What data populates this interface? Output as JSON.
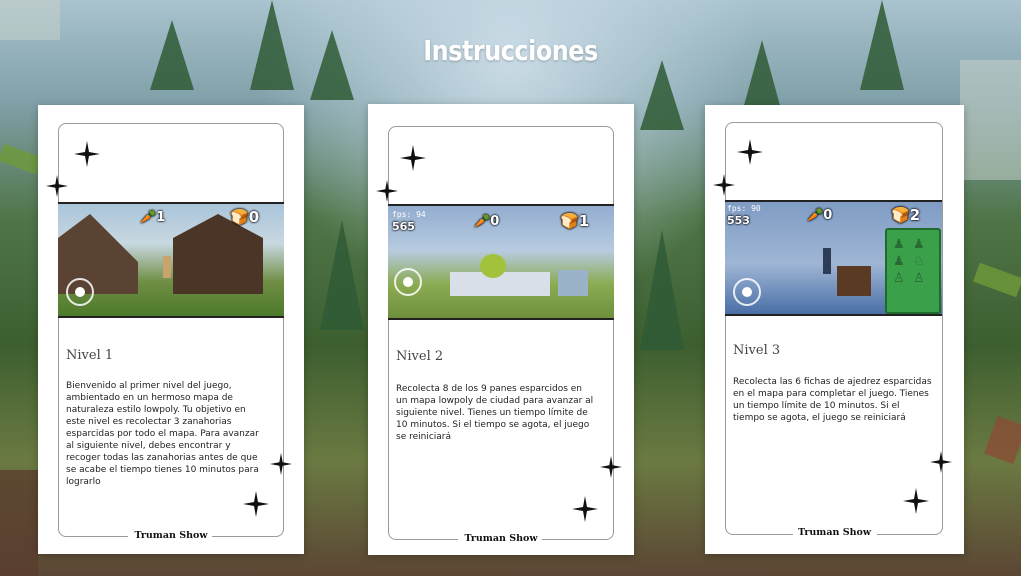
{
  "title": "Instrucciones",
  "cards": [
    {
      "level": "Nivel 1",
      "description": "Bienvenido al primer nivel del juego, ambientado en un hermoso mapa de naturaleza estilo lowpoly. Tu objetivo en este nivel es recolectar 3 zanahorias esparcidas por todo el mapa. Para avanzar al siguiente nivel, debes encontrar y recoger todas las zanahorias antes de que se acabe el tiempo tienes 10 minutos para lograrlo",
      "footer": "Truman Show",
      "hud": {
        "carrots": "1",
        "bread": "0"
      }
    },
    {
      "level": "Nivel 2",
      "description": "Recolecta 8 de los 9 panes esparcidos en un mapa lowpoly de ciudad para avanzar al siguiente nivel. Tienes un tiempo límite de 10 minutos. Si el tiempo se agota, el juego se reiniciará",
      "footer": "Truman Show",
      "hud": {
        "fps": "fps: 94",
        "counter": "565",
        "carrots": "0",
        "bread": "1"
      }
    },
    {
      "level": "Nivel 3",
      "description": "Recolecta las 6 fichas de ajedrez esparcidas en el mapa para completar el juego. Tienes un tiempo límite de 10 minutos. Si el tiempo se agota, el juego se reiniciará",
      "footer": "Truman Show",
      "hud": {
        "fps": "fps: 90",
        "counter": "553",
        "carrots": "0",
        "bread": "2"
      }
    }
  ]
}
